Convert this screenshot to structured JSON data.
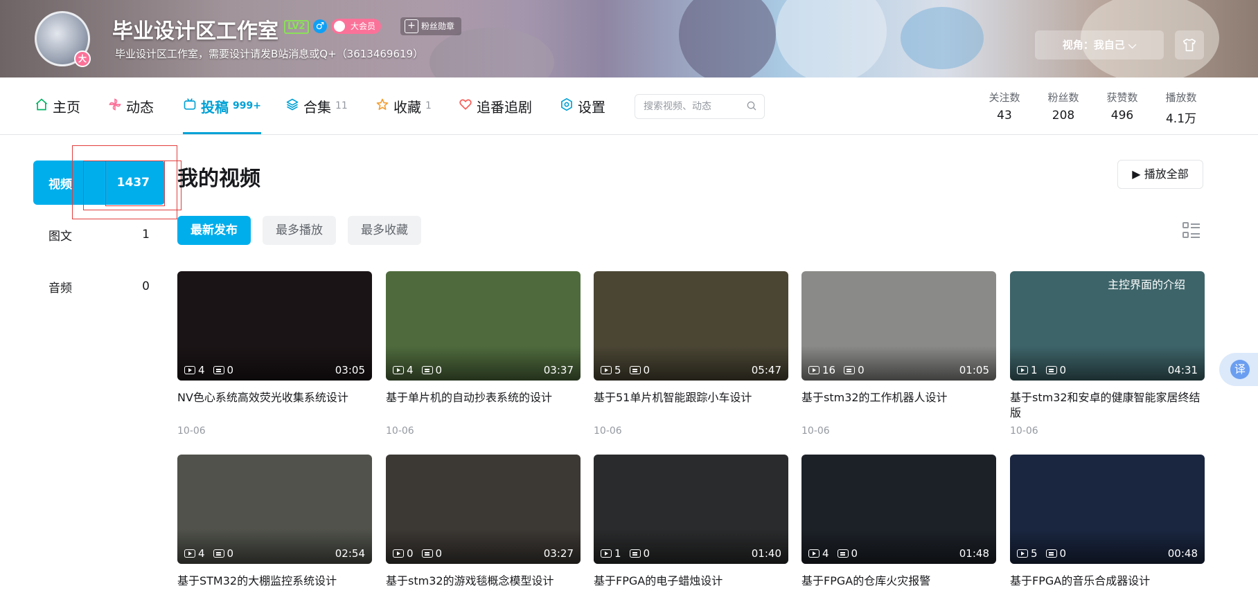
{
  "header": {
    "username": "毕业设计区工作室",
    "level": "LV2",
    "gender_symbol": "♂",
    "vip_label": "大会员",
    "fan_medal_label": "粉丝勋章",
    "sign": "毕业设计区工作室，需要设计请发B站消息或Q+（3613469619）",
    "avatar_badge": "大",
    "view_as_label": "视角：我自己 ⌵"
  },
  "nav": {
    "items": [
      {
        "label": "主页",
        "count": "",
        "icon": "home-icon"
      },
      {
        "label": "动态",
        "count": "",
        "icon": "pinwheel-icon"
      },
      {
        "label": "投稿",
        "count": "999+",
        "icon": "tv-icon"
      },
      {
        "label": "合集",
        "count": "11",
        "icon": "layers-icon"
      },
      {
        "label": "收藏",
        "count": "1",
        "icon": "star-icon"
      },
      {
        "label": "追番追剧",
        "count": "",
        "icon": "heart-icon"
      },
      {
        "label": "设置",
        "count": "",
        "icon": "settings-icon"
      }
    ],
    "search_placeholder": "搜索视频、动态",
    "stats": [
      {
        "label": "关注数",
        "value": "43"
      },
      {
        "label": "粉丝数",
        "value": "208"
      },
      {
        "label": "获赞数",
        "value": "496"
      },
      {
        "label": "播放数",
        "value": "4.1万"
      }
    ]
  },
  "sidebar": {
    "items": [
      {
        "label": "视频",
        "count": "1437"
      },
      {
        "label": "图文",
        "count": "1"
      },
      {
        "label": "音频",
        "count": "0"
      }
    ]
  },
  "main": {
    "title": "我的视频",
    "play_all": "▶ 播放全部",
    "sort_tabs": [
      "最新发布",
      "最多播放",
      "最多收藏"
    ],
    "videos": [
      {
        "title": "NV色心系统高效荧光收集系统设计",
        "plays": "4",
        "danmaku": "0",
        "duration": "03:05",
        "date": "10-06",
        "bg": "#1b1416"
      },
      {
        "title": "基于单片机的自动抄表系统的设计",
        "plays": "4",
        "danmaku": "0",
        "duration": "03:37",
        "date": "10-06",
        "bg": "#4f6b3d"
      },
      {
        "title": "基于51单片机智能跟踪小车设计",
        "plays": "5",
        "danmaku": "0",
        "duration": "05:47",
        "date": "10-06",
        "bg": "#4b4634"
      },
      {
        "title": "基于stm32的工作机器人设计",
        "plays": "16",
        "danmaku": "0",
        "duration": "01:05",
        "date": "10-06",
        "bg": "#8a8a88"
      },
      {
        "title": "基于stm32和安卓的健康智能家居终结版",
        "plays": "1",
        "danmaku": "0",
        "duration": "04:31",
        "date": "10-06",
        "bg": "#3d6469"
      },
      {
        "title": "基于STM32的大棚监控系统设计",
        "plays": "4",
        "danmaku": "0",
        "duration": "02:54",
        "date": "",
        "bg": "#50524b"
      },
      {
        "title": "基于stm32的游戏毯概念模型设计",
        "plays": "0",
        "danmaku": "0",
        "duration": "03:27",
        "date": "",
        "bg": "#3c3834"
      },
      {
        "title": "基于FPGA的电子蜡烛设计",
        "plays": "1",
        "danmaku": "0",
        "duration": "01:40",
        "date": "",
        "bg": "#2a2b2c"
      },
      {
        "title": "基于FPGA的仓库火灾报警",
        "plays": "4",
        "danmaku": "0",
        "duration": "01:48",
        "date": "",
        "bg": "#1c2128"
      },
      {
        "title": "基于FPGA的音乐合成器设计",
        "plays": "5",
        "danmaku": "0",
        "duration": "00:48",
        "date": "",
        "bg": "#1a2640"
      }
    ]
  },
  "thumb_caption_5": "主控界面的介绍",
  "translate_label": "译",
  "colors": {
    "accent": "#00aeec",
    "nav_active": "#00a1d6",
    "pink": "#fb7299"
  }
}
